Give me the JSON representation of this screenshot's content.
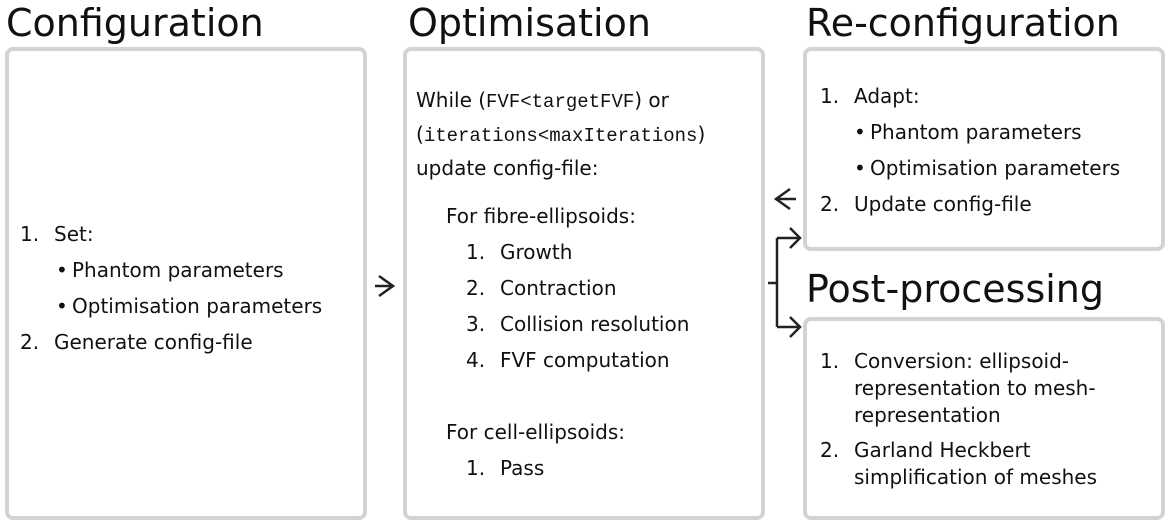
{
  "configuration": {
    "title": "Configuration",
    "items": [
      {
        "num": "1.",
        "label": "Set:",
        "sub": [
          "Phantom parameters",
          "Optimisation parameters"
        ]
      },
      {
        "num": "2.",
        "label": "Generate config-file"
      }
    ]
  },
  "optimisation": {
    "title": "Optimisation",
    "while_word": "While (",
    "cond1": "FVF<targetFVF",
    "or_word": ") or",
    "cond2_open": "(",
    "cond2": "iterations<maxIterations",
    "cond2_close": ")",
    "update": "update config-file:",
    "fibre_heading": "For fibre-ellipsoids:",
    "fibre_steps": [
      {
        "num": "1.",
        "label": "Growth"
      },
      {
        "num": "2.",
        "label": "Contraction"
      },
      {
        "num": "3.",
        "label": "Collision resolution"
      },
      {
        "num": "4.",
        "label": "FVF computation"
      }
    ],
    "cell_heading": "For cell-ellipsoids:",
    "cell_steps": [
      {
        "num": "1.",
        "label": "Pass"
      }
    ]
  },
  "reconfiguration": {
    "title": "Re-configuration",
    "items": [
      {
        "num": "1.",
        "label": "Adapt:",
        "sub": [
          "Phantom parameters",
          "Optimisation parameters"
        ]
      },
      {
        "num": "2.",
        "label": "Update config-file"
      }
    ]
  },
  "postprocessing": {
    "title": "Post-processing",
    "items": [
      {
        "num": "1.",
        "lines": [
          "Conversion: ellipsoid-",
          "representation to mesh-",
          "representation"
        ]
      },
      {
        "num": "2.",
        "lines": [
          "Garland Heckbert",
          "simplification of meshes"
        ]
      }
    ]
  },
  "bullet": "•"
}
